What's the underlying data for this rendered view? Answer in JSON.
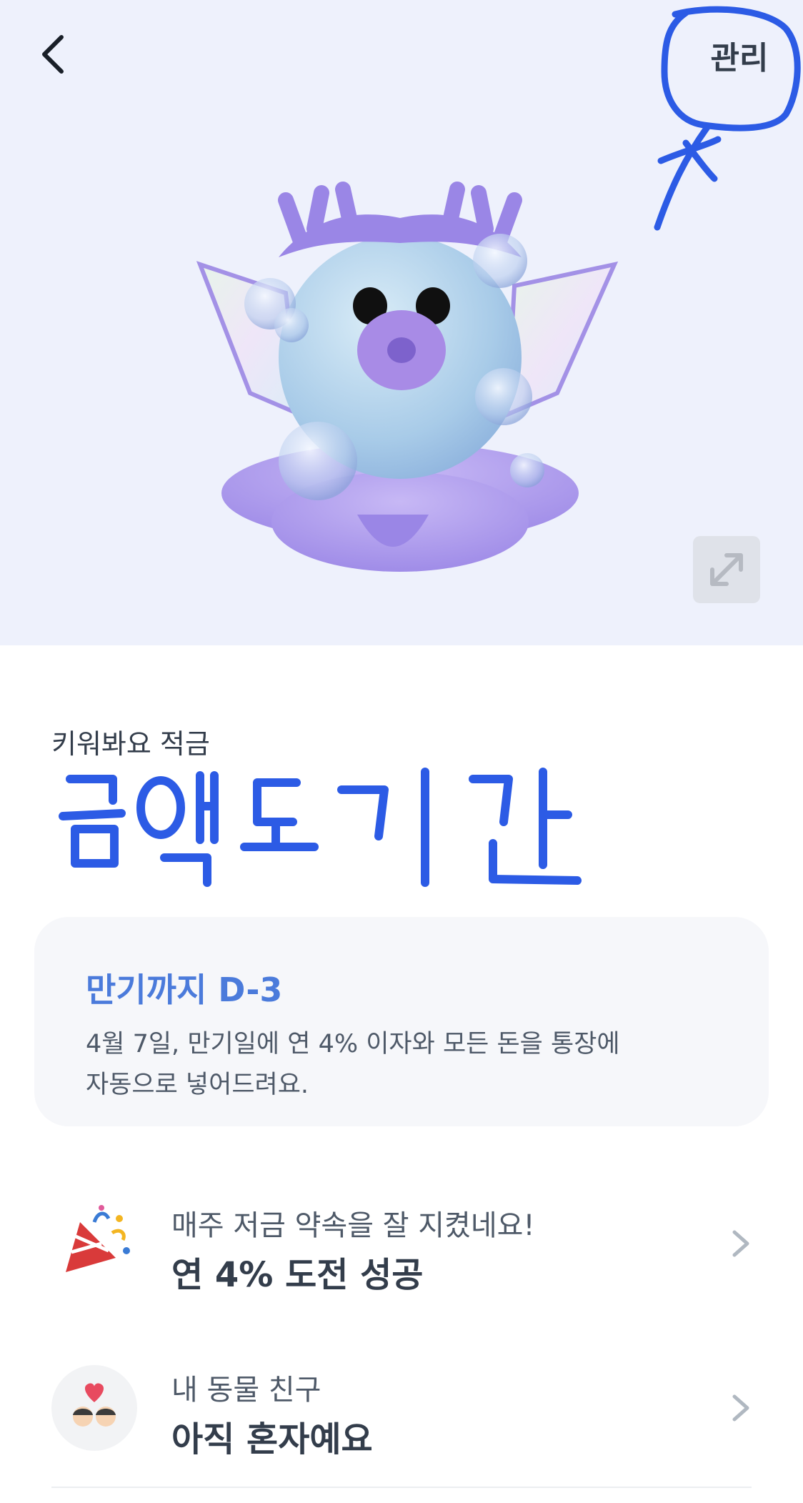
{
  "header": {
    "manage_label": "관리"
  },
  "product": {
    "name": "키워봐요 적금"
  },
  "maturity": {
    "title": "만기까지 D-3",
    "description_line1": "4월 7일, 만기일에 연 4% 이자와 모든 돈을 통장에",
    "description_line2": "자동으로 넣어드려요."
  },
  "rows": [
    {
      "subtitle": "매주 저금 약속을 잘 지켰네요!",
      "title": "연 4% 도전 성공",
      "icon": "party-popper-icon"
    },
    {
      "subtitle": "내 동물 친구",
      "title": "아직 혼자예요",
      "icon": "friends-heart-icon"
    }
  ],
  "colors": {
    "hero_background": "#eef1fc",
    "accent_blue": "#4b7bdb",
    "annotation_blue": "#2c5be5",
    "card_background": "#f6f7fa"
  }
}
